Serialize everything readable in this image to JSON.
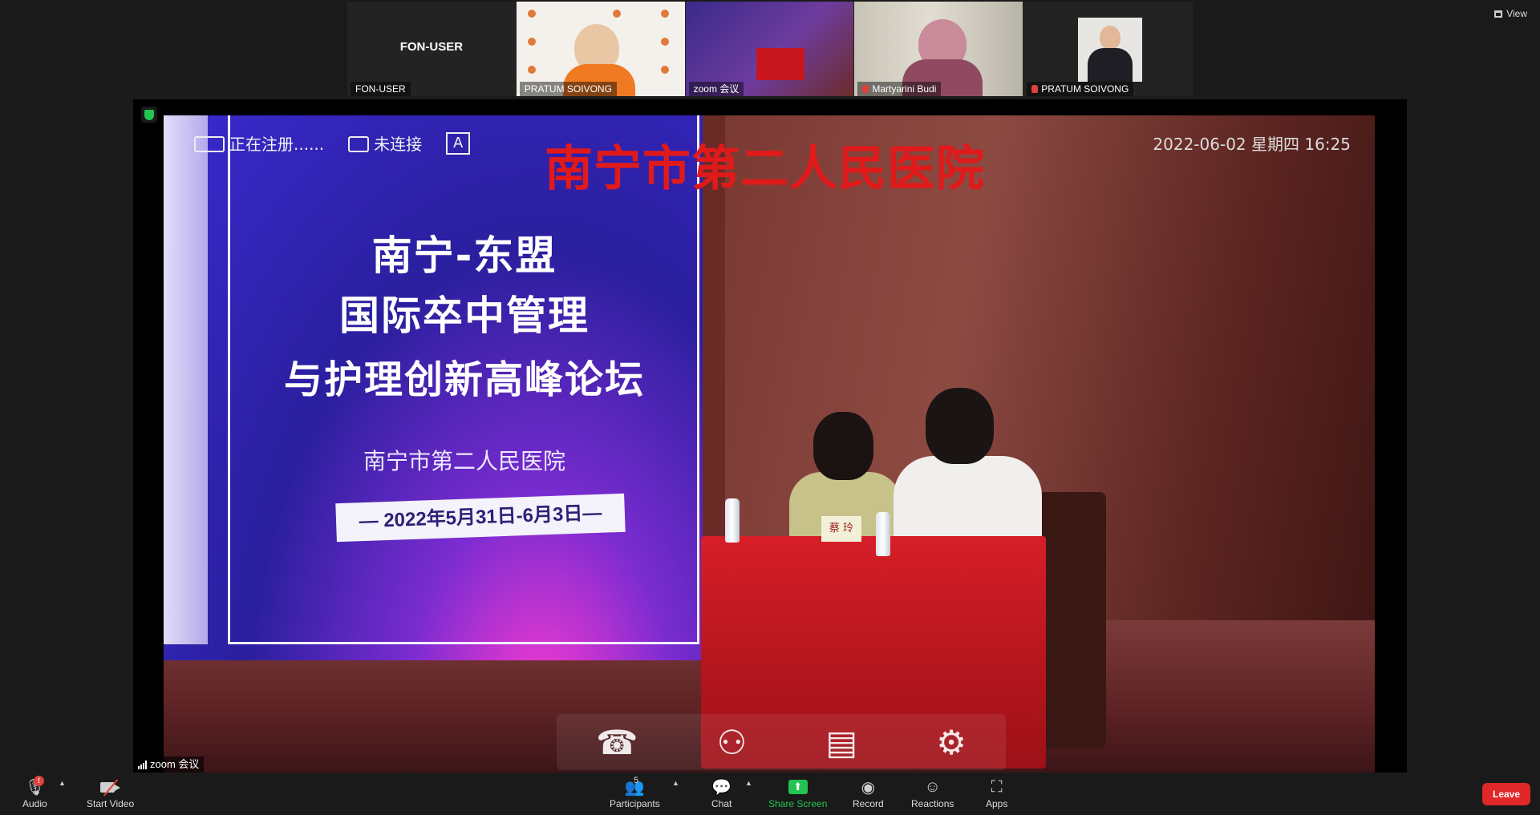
{
  "window": {
    "view_label": "View"
  },
  "gallery": {
    "tiles": [
      {
        "name": "FON-USER",
        "center_name": "FON-USER"
      },
      {
        "name": "PRATUM SOIVONG"
      },
      {
        "name": "zoom 会议"
      },
      {
        "name": "Martyarini Budi"
      },
      {
        "name": "PRATUM SOIVONG"
      }
    ]
  },
  "stage": {
    "speaker_label": "zoom 会议",
    "osd": {
      "registering": "正在注册......",
      "not_connected": "未连接",
      "a_box": "A"
    },
    "hospital_title": "南宁市第二人民医院",
    "datetime": "2022-06-02 星期四 16:25",
    "slide": {
      "line1": "南宁-东盟",
      "line2": "国际卒中管理",
      "line3": "与护理创新高峰论坛",
      "subtitle": "南宁市第二人民医院",
      "date_range": "— 2022年5月31日-6月3日—"
    },
    "nameplate": "蔡 玲"
  },
  "toolbar": {
    "audio_label": "Audio",
    "audio_badge": "!",
    "video_label": "Start Video",
    "participants_label": "Participants",
    "participants_count": "5",
    "chat_label": "Chat",
    "share_label": "Share Screen",
    "record_label": "Record",
    "reactions_label": "Reactions",
    "apps_label": "Apps",
    "leave_label": "Leave"
  },
  "colors": {
    "accent_green": "#23c552",
    "leave_red": "#e02828",
    "hospital_red": "#e01a1a",
    "active_speaker": "#c2d82d"
  }
}
